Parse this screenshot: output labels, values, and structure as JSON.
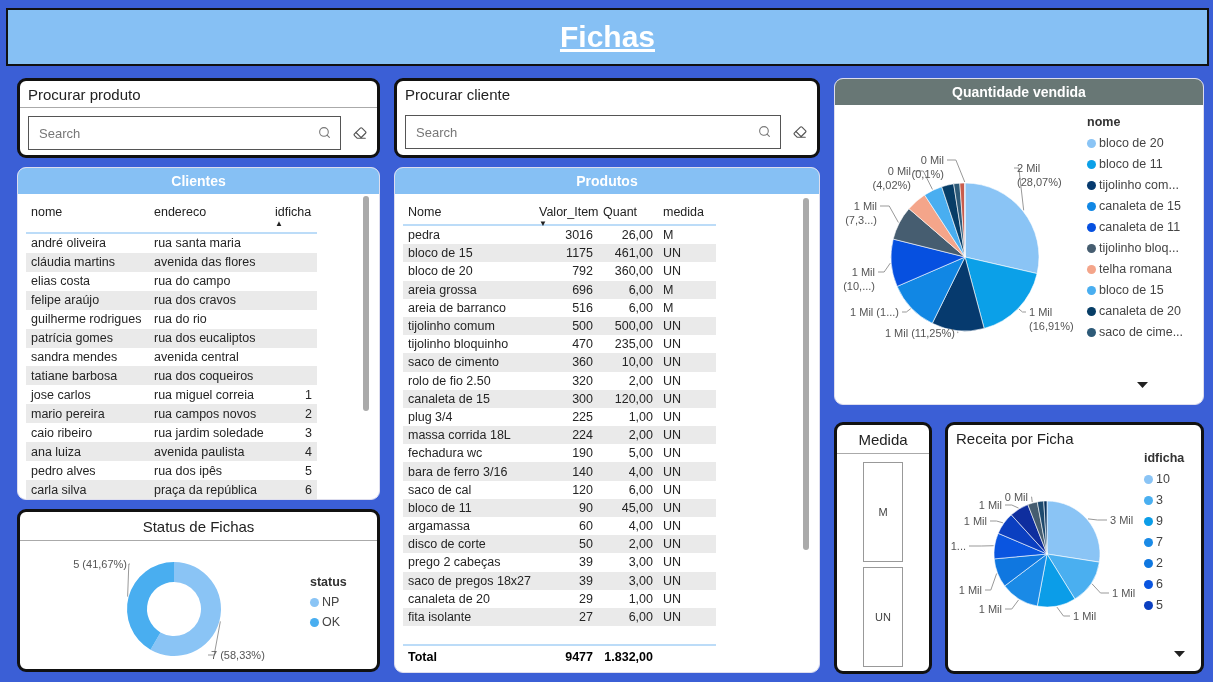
{
  "header": {
    "title": "Fichas"
  },
  "search_cards": [
    {
      "title": "Procurar produto",
      "placeholder": "Search"
    },
    {
      "title": "Procurar cliente",
      "placeholder": "Search"
    }
  ],
  "clientes": {
    "title": "Clientes",
    "columns": [
      {
        "label": "nome"
      },
      {
        "label": "endereco"
      },
      {
        "label": "idficha",
        "sort_icon": "▲"
      }
    ],
    "rows": [
      [
        "andré oliveira",
        "rua santa maria"
      ],
      [
        "cláudia martins",
        "avenida das flores"
      ],
      [
        "elias costa",
        "rua do campo"
      ],
      [
        "felipe araújo",
        "rua dos cravos"
      ],
      [
        "guilherme rodrigues",
        "rua do rio"
      ],
      [
        "patrícia gomes",
        "rua dos eucaliptos"
      ],
      [
        "sandra mendes",
        "avenida central"
      ],
      [
        "tatiane barbosa",
        "rua dos coqueiros"
      ],
      [
        "jose carlos",
        "rua miguel correia",
        "1"
      ],
      [
        "mario pereira",
        "rua campos novos",
        "2"
      ],
      [
        "caio ribeiro",
        "rua jardim soledade",
        "3"
      ],
      [
        "ana luiza",
        "avenida paulista",
        "4"
      ],
      [
        "pedro alves",
        "rua dos ipês",
        "5"
      ],
      [
        "carla silva",
        "praça da república",
        "6"
      ]
    ]
  },
  "status": {
    "title": "Status de Fichas",
    "legend_title": "status",
    "chart_data": {
      "type": "donut",
      "categories": [
        "NP",
        "OK"
      ],
      "values": [
        58.33,
        41.67
      ],
      "colors": [
        "#8ac4f5",
        "#49aef0"
      ],
      "value_labels": [
        [
          "7 (58,33%)"
        ],
        [
          "5 (41,67%)"
        ]
      ]
    }
  },
  "produtos": {
    "title": "Produtos",
    "columns": [
      {
        "label": "Nome"
      },
      {
        "label": "Valor_Item",
        "sort_icon": "▼"
      },
      {
        "label": "Quant"
      },
      {
        "label": "medida"
      }
    ],
    "rows": [
      [
        "pedra",
        "3016",
        "26,00",
        "M"
      ],
      [
        "bloco de 15",
        "1175",
        "461,00",
        "UN"
      ],
      [
        "bloco de 20",
        "792",
        "360,00",
        "UN"
      ],
      [
        "areia grossa",
        "696",
        "6,00",
        "M"
      ],
      [
        "areia de barranco",
        "516",
        "6,00",
        "M"
      ],
      [
        "tijolinho comum",
        "500",
        "500,00",
        "UN"
      ],
      [
        "tijolinho bloquinho",
        "470",
        "235,00",
        "UN"
      ],
      [
        "saco de cimento",
        "360",
        "10,00",
        "UN"
      ],
      [
        "rolo de fio 2.50",
        "320",
        "2,00",
        "UN"
      ],
      [
        "canaleta de 15",
        "300",
        "120,00",
        "UN"
      ],
      [
        "plug 3/4",
        "225",
        "1,00",
        "UN"
      ],
      [
        "massa corrida 18L",
        "224",
        "2,00",
        "UN"
      ],
      [
        "fechadura wc",
        "190",
        "5,00",
        "UN"
      ],
      [
        "bara de ferro 3/16",
        "140",
        "4,00",
        "UN"
      ],
      [
        "saco de cal",
        "120",
        "6,00",
        "UN"
      ],
      [
        "bloco de 11",
        "90",
        "45,00",
        "UN"
      ],
      [
        "argamassa",
        "60",
        "4,00",
        "UN"
      ],
      [
        "disco de corte",
        "50",
        "2,00",
        "UN"
      ],
      [
        "prego 2 cabeças",
        "39",
        "3,00",
        "UN"
      ],
      [
        "saco de pregos 18x27",
        "39",
        "3,00",
        "UN"
      ],
      [
        "canaleta de 20",
        "29",
        "1,00",
        "UN"
      ],
      [
        "fita isolante",
        "27",
        "6,00",
        "UN"
      ]
    ],
    "total": {
      "label": "Total",
      "values": [
        "9477",
        "1.832,00"
      ]
    }
  },
  "quantidade": {
    "title": "Quantidade vendida",
    "legend_title": "nome",
    "chart_data": {
      "type": "pie",
      "categories": [
        "bloco de 20",
        "bloco de 11",
        "tijolinho com...",
        "canaleta de 15",
        "canaleta de 11",
        "tijolinho bloq...",
        "telha romana",
        "bloco de 15",
        "canaleta de 20",
        "saco de cime...",
        null,
        null
      ],
      "values": [
        28.07,
        16.91,
        11.25,
        11.0,
        10.2,
        7.3,
        4.4,
        4.02,
        2.6,
        1.3,
        1.0,
        0.1
      ],
      "colors": [
        "#8ac4f5",
        "#0ba0e8",
        "#063a6e",
        "#1187e4",
        "#0650e0",
        "#465d70",
        "#f4a58a",
        "#49aef0",
        "#073d66",
        "#2d5a78",
        "#c85c4d",
        "#5b6bb0"
      ],
      "value_labels": [
        [
          "2 Mil",
          "(28,07%)"
        ],
        [
          "1 Mil",
          "(16,91%)"
        ],
        [
          "1 Mil (11,25%)"
        ],
        [
          "1 Mil (1...)"
        ],
        [
          "1 Mil",
          "(10,...)"
        ],
        [
          "1 Mil",
          "(7,3...)"
        ],
        null,
        [
          "0 Mil",
          "(4,02%)"
        ],
        null,
        null,
        null,
        [
          "0 Mil",
          "(0,1%)"
        ]
      ]
    }
  },
  "medida": {
    "title": "Medida",
    "options": [
      {
        "label": "M",
        "selected": false
      },
      {
        "label": "UN",
        "selected": false
      }
    ]
  },
  "receita": {
    "title": "Receita por Ficha",
    "legend_title": "idficha",
    "chart_data": {
      "type": "pie",
      "categories": [
        "10",
        "3",
        "9",
        "7",
        "2",
        "6",
        "5",
        null,
        null,
        null,
        null
      ],
      "values": [
        28,
        14,
        12,
        12,
        9,
        8,
        7,
        6,
        3,
        2,
        1
      ],
      "colors": [
        "#8ac4f5",
        "#4aaff0",
        "#0b9de8",
        "#1a8ae6",
        "#0f77e0",
        "#0a55e0",
        "#0b3fc0",
        "#0f2e9e",
        "#465d70",
        "#1e4a6e",
        "#0a3560"
      ],
      "value_labels": [
        [
          "3 Mil"
        ],
        [
          "1 Mil"
        ],
        [
          "1 Mil"
        ],
        [
          "1 Mil"
        ],
        [
          "1 Mil"
        ],
        [
          "1..."
        ],
        [
          "1 Mil"
        ],
        [
          "1 Mil"
        ],
        [
          "0 Mil"
        ],
        null,
        null
      ]
    }
  }
}
